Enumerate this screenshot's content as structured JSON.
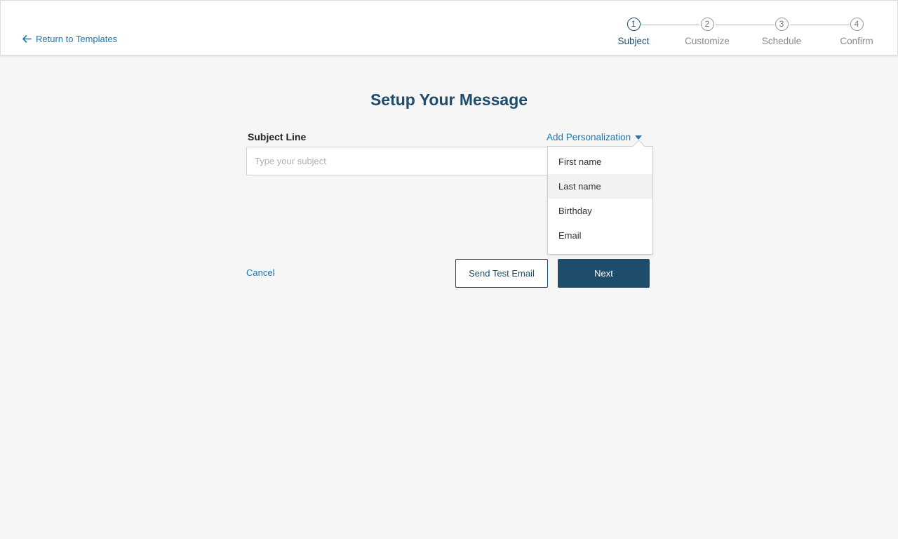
{
  "header": {
    "back_label": "Return to Templates",
    "steps": [
      {
        "number": "1",
        "label": "Subject",
        "active": true
      },
      {
        "number": "2",
        "label": "Customize",
        "active": false
      },
      {
        "number": "3",
        "label": "Schedule",
        "active": false
      },
      {
        "number": "4",
        "label": "Confirm",
        "active": false
      }
    ]
  },
  "main": {
    "title": "Setup Your Message",
    "subject_label": "Subject Line",
    "subject_placeholder": "Type your subject",
    "subject_value": "",
    "personalization_label": "Add Personalization",
    "personalization_options": [
      "First name",
      "Last name",
      "Birthday",
      "Email"
    ],
    "highlighted_option": "Last name"
  },
  "footer": {
    "cancel_label": "Cancel",
    "test_email_label": "Send Test Email",
    "next_label": "Next"
  },
  "colors": {
    "primary": "#1e4d6b",
    "link": "#1a78b4",
    "background": "#f6f6f6"
  }
}
